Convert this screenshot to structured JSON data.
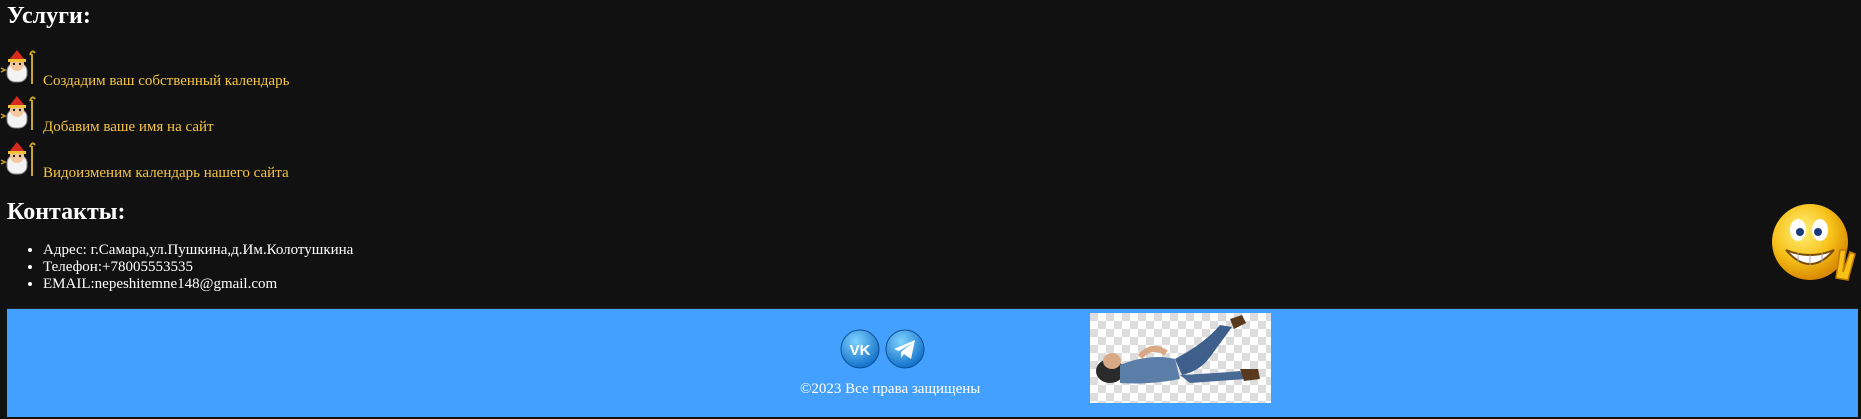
{
  "services": {
    "title": "Услуги:",
    "items": [
      {
        "label": "Создадим ваш собственный календарь",
        "icon": "saint-nicholas-icon"
      },
      {
        "label": "Добавим ваше имя на сайт",
        "icon": "saint-nicholas-icon"
      },
      {
        "label": "Видоизменим календарь нашего сайта",
        "icon": "saint-nicholas-icon"
      }
    ]
  },
  "contacts": {
    "title": "Контакты:",
    "items": [
      "Адрес: г.Самара,ул.Пушкина,д.Им.Колотушкина",
      "Телефон:+78005553535",
      "EMAIL:nepeshitemne148@gmail.com"
    ]
  },
  "footer": {
    "social": [
      {
        "name": "vk-icon",
        "color": "#2a8ad8"
      },
      {
        "name": "telegram-icon",
        "color": "#2a8ad8"
      }
    ],
    "copyright": "©2023 Все права защищены",
    "background": "#44a0ff"
  },
  "colors": {
    "page_background": "#111111",
    "service_text": "#f5c542",
    "heading_text": "#ffffff"
  },
  "decorations": {
    "smiley": "grinning-smiley-peace-icon",
    "photo": "reclining-man-photo"
  }
}
